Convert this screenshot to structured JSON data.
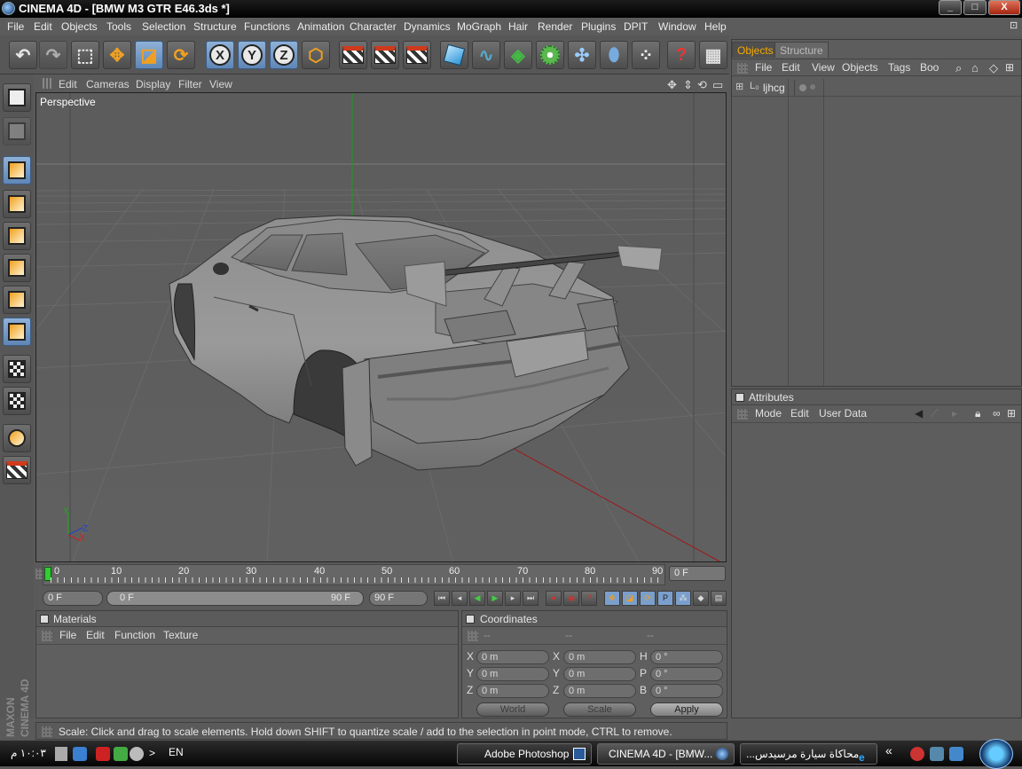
{
  "window": {
    "title": "CINEMA 4D - [BMW M3 GTR E46.3ds *]",
    "min": "_",
    "max": "□",
    "close": "X"
  },
  "menu": [
    "File",
    "Edit",
    "Objects",
    "Tools",
    "Selection",
    "Structure",
    "Functions",
    "Animation",
    "Character",
    "Dynamics",
    "MoGraph",
    "Hair",
    "Render",
    "Plugins",
    "DPIT",
    "Window",
    "Help"
  ],
  "viewport": {
    "menu": [
      "Edit",
      "Cameras",
      "Display",
      "Filter",
      "View"
    ],
    "label": "Perspective",
    "axis_labels": {
      "y": "Y",
      "z": "Z",
      "x": "X"
    }
  },
  "timeline": {
    "ticks": [
      "0",
      "10",
      "20",
      "30",
      "40",
      "50",
      "60",
      "70",
      "80",
      "90"
    ],
    "current_frame": "0 F",
    "start": "0 F",
    "range_start": "0 F",
    "range_end": "90 F",
    "end": "90 F"
  },
  "materials": {
    "title": "Materials",
    "menu": [
      "File",
      "Edit",
      "Function",
      "Texture"
    ]
  },
  "coordinates": {
    "title": "Coordinates",
    "col_heads": [
      "--",
      "--",
      "--"
    ],
    "rows": [
      {
        "a": "X",
        "av": "0 m",
        "b": "X",
        "bv": "0 m",
        "c": "H",
        "cv": "0 °"
      },
      {
        "a": "Y",
        "av": "0 m",
        "b": "Y",
        "bv": "0 m",
        "c": "P",
        "cv": "0 °"
      },
      {
        "a": "Z",
        "av": "0 m",
        "b": "Z",
        "bv": "0 m",
        "c": "B",
        "cv": "0 °"
      }
    ],
    "space": "World",
    "mode": "Scale",
    "apply": "Apply"
  },
  "status": "Scale: Click and drag to scale elements. Hold down SHIFT to quantize scale / add to the selection in point mode, CTRL to remove.",
  "objects_panel": {
    "tabs": [
      "Objects",
      "Structure"
    ],
    "menu": [
      "File",
      "Edit",
      "View",
      "Objects",
      "Tags",
      "Boo"
    ],
    "items": [
      {
        "name": "ljhcg"
      }
    ]
  },
  "attributes_panel": {
    "title": "Attributes",
    "menu": [
      "Mode",
      "Edit",
      "User Data"
    ]
  },
  "brand": {
    "line1": "MAXON",
    "line2": "CINEMA 4D"
  },
  "taskbar": {
    "tasks": [
      "Adobe Photoshop",
      "CINEMA 4D - [BMW...",
      "محاكاة سيارة مرسيدس..."
    ],
    "clock": "١٠:٠٣ م",
    "lang": "EN",
    "chevron": "«",
    "arrow": ">"
  },
  "colors": {
    "accent_tab": "#f4a900",
    "selected_tool": "#7a9fcc",
    "axis_x": "#c02020",
    "axis_y": "#20a020",
    "axis_z": "#2040c0"
  }
}
